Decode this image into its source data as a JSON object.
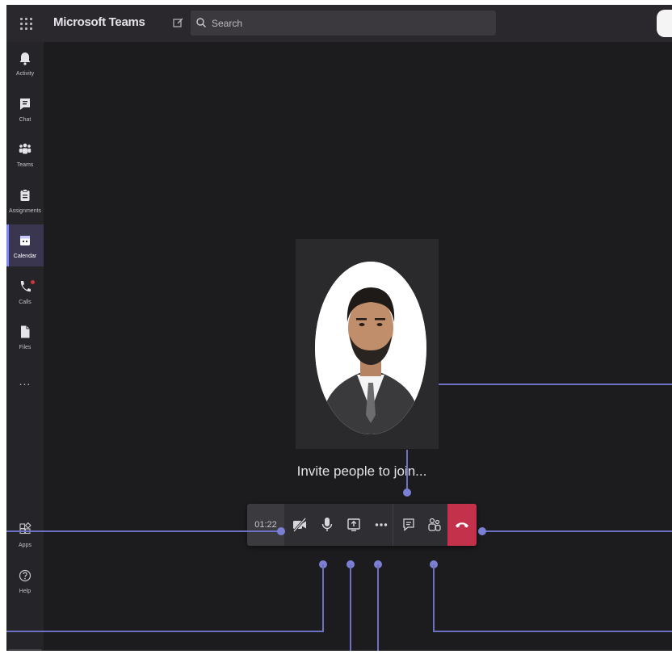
{
  "topbar": {
    "app_title": "Microsoft Teams",
    "search_placeholder": "Search"
  },
  "sidebar": {
    "items": [
      {
        "label": "Activity",
        "icon": "bell-icon"
      },
      {
        "label": "Chat",
        "icon": "chat-icon"
      },
      {
        "label": "Teams",
        "icon": "teams-icon"
      },
      {
        "label": "Assignments",
        "icon": "assignments-icon"
      },
      {
        "label": "Calendar",
        "icon": "calendar-icon",
        "active": true
      },
      {
        "label": "Calls",
        "icon": "phone-icon",
        "badge": true
      },
      {
        "label": "Files",
        "icon": "file-icon"
      }
    ],
    "more": "...",
    "bottom_items": [
      {
        "label": "Apps",
        "icon": "apps-icon"
      },
      {
        "label": "Help",
        "icon": "help-icon"
      }
    ]
  },
  "stage": {
    "invite_text": "Invite people to join..."
  },
  "call_controls": {
    "timer": "01:22",
    "buttons": [
      "camera-off-icon",
      "microphone-icon",
      "share-screen-icon",
      "more-actions-icon",
      "chat-icon",
      "participants-icon",
      "hang-up-icon"
    ]
  },
  "colors": {
    "accent": "#7f85f5",
    "hangup": "#c4314b",
    "callout_line": "#6d71c4"
  }
}
